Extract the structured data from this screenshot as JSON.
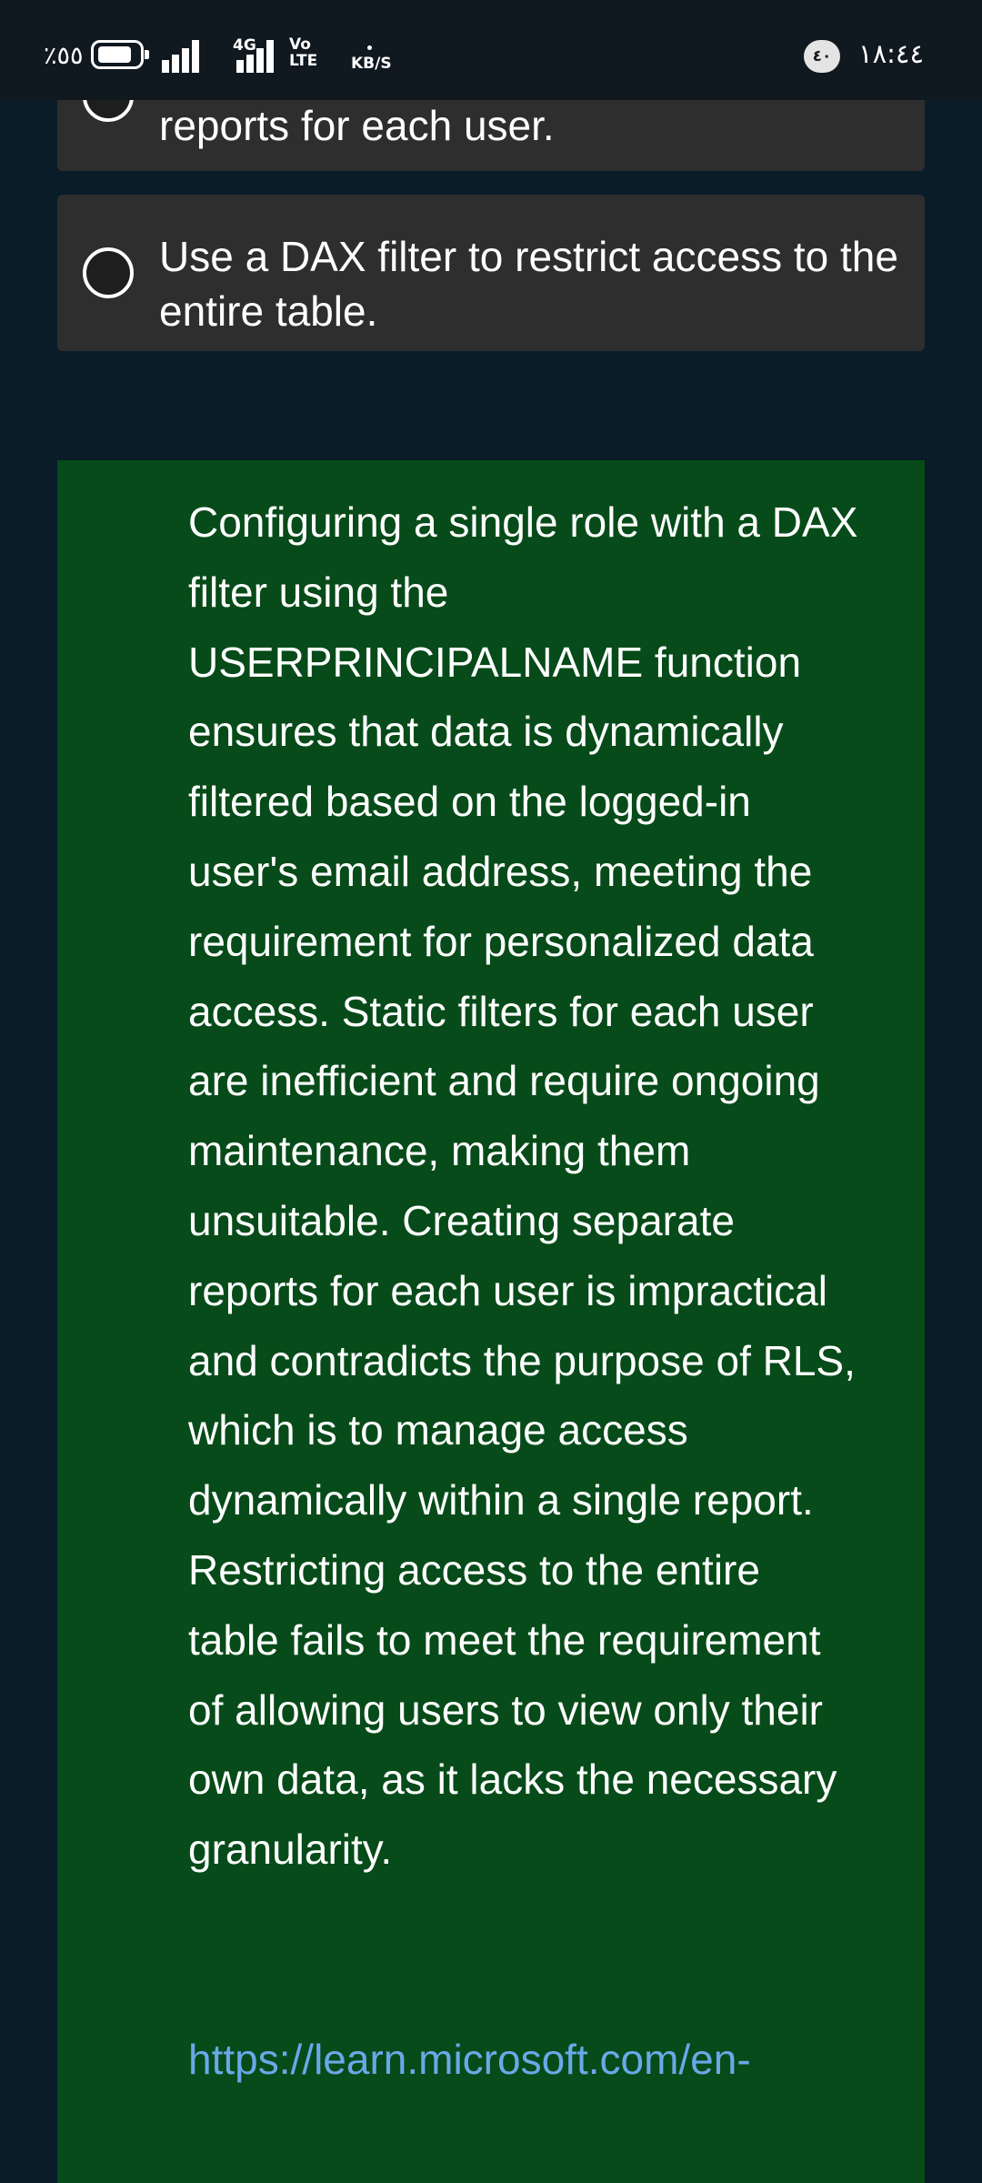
{
  "status_bar": {
    "battery_percent": "٪٥٥",
    "network_type": "4G",
    "volte_label": "Vo\nLTE",
    "speed_unit": "KB/S",
    "notification_count": "٤٠",
    "time": "١٨:٤٤"
  },
  "options": [
    {
      "text": "reports for each user.",
      "selected": false
    },
    {
      "text": "Use a DAX filter to restrict access to the entire table.",
      "selected": false
    }
  ],
  "explanation": {
    "text": "Configuring a single role with a DAX filter using the USERPRINCIPALNAME function ensures that data is dynamically filtered based on the logged-in user's email address, meeting the requirement for personalized data access. Static filters for each user are inefficient and require ongoing maintenance, making them unsuitable. Creating separate reports for each user is impractical and contradicts the purpose of RLS, which is to manage access dynamically within a single report. Restricting access to the entire table fails to meet the requirement of allowing users to view only their own data, as it lacks the necessary granularity.",
    "link": "https://learn.microsoft.com/en-"
  },
  "colors": {
    "background": "#0a1c28",
    "status_bar": "#101820",
    "option_card": "#2e2e2e",
    "explanation_panel": "#064b19",
    "link": "#6aa8e8"
  }
}
